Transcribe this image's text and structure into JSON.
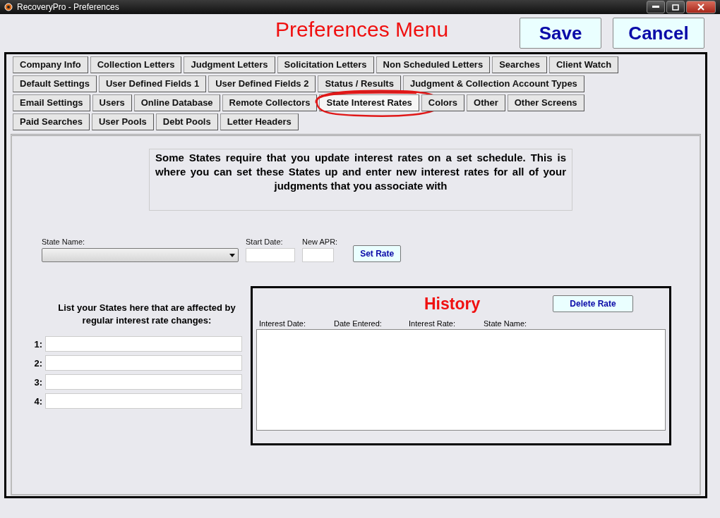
{
  "window": {
    "title": "RecoveryPro - Preferences"
  },
  "header": {
    "title": "Preferences Menu",
    "buttons": [
      "Save",
      "Cancel"
    ]
  },
  "tabs": [
    [
      {
        "label": "Company Info",
        "selected": false,
        "circled": false
      },
      {
        "label": "Collection Letters",
        "selected": false,
        "circled": false
      },
      {
        "label": "Judgment Letters",
        "selected": false,
        "circled": false
      },
      {
        "label": "Solicitation Letters",
        "selected": false,
        "circled": false
      },
      {
        "label": "Non Scheduled Letters",
        "selected": false,
        "circled": false
      },
      {
        "label": "Searches",
        "selected": false,
        "circled": false
      },
      {
        "label": "Client Watch",
        "selected": false,
        "circled": false
      }
    ],
    [
      {
        "label": "Default Settings",
        "selected": false,
        "circled": false
      },
      {
        "label": "User Defined Fields 1",
        "selected": false,
        "circled": false
      },
      {
        "label": "User Defined Fields 2",
        "selected": false,
        "circled": false
      },
      {
        "label": "Status / Results",
        "selected": false,
        "circled": false
      },
      {
        "label": "Judgment & Collection Account Types",
        "selected": false,
        "circled": false
      }
    ],
    [
      {
        "label": "Email Settings",
        "selected": false,
        "circled": false
      },
      {
        "label": "Users",
        "selected": false,
        "circled": false
      },
      {
        "label": "Online Database",
        "selected": false,
        "circled": false
      },
      {
        "label": "Remote Collectors",
        "selected": false,
        "circled": false
      },
      {
        "label": "State Interest Rates",
        "selected": true,
        "circled": true
      },
      {
        "label": "Colors",
        "selected": false,
        "circled": false
      },
      {
        "label": "Other",
        "selected": false,
        "circled": false
      },
      {
        "label": "Other Screens",
        "selected": false,
        "circled": false
      }
    ],
    [
      {
        "label": "Paid Searches",
        "selected": false,
        "circled": false
      },
      {
        "label": "User Pools",
        "selected": false,
        "circled": false
      },
      {
        "label": "Debt Pools",
        "selected": false,
        "circled": false
      },
      {
        "label": "Letter Headers",
        "selected": false,
        "circled": false
      }
    ]
  ],
  "description": "Some States require that you update interest rates on a set schedule. This is where you can set these States up and enter new interest rates for all of your judgments that you associate with",
  "rate_form": {
    "state_name_label": "State Name:",
    "start_date_label": "Start Date:",
    "new_apr_label": "New APR:",
    "button": "Set Rate"
  },
  "state_list": {
    "heading": "List your States here that are affected by regular interest rate changes:",
    "rows": [
      "1:",
      "2:",
      "3:",
      "4:"
    ]
  },
  "history": {
    "title": "History",
    "button": "Delete Rate",
    "columns": [
      "Interest Date:",
      "Date Entered:",
      "Interest Rate:",
      "State Name:"
    ]
  }
}
